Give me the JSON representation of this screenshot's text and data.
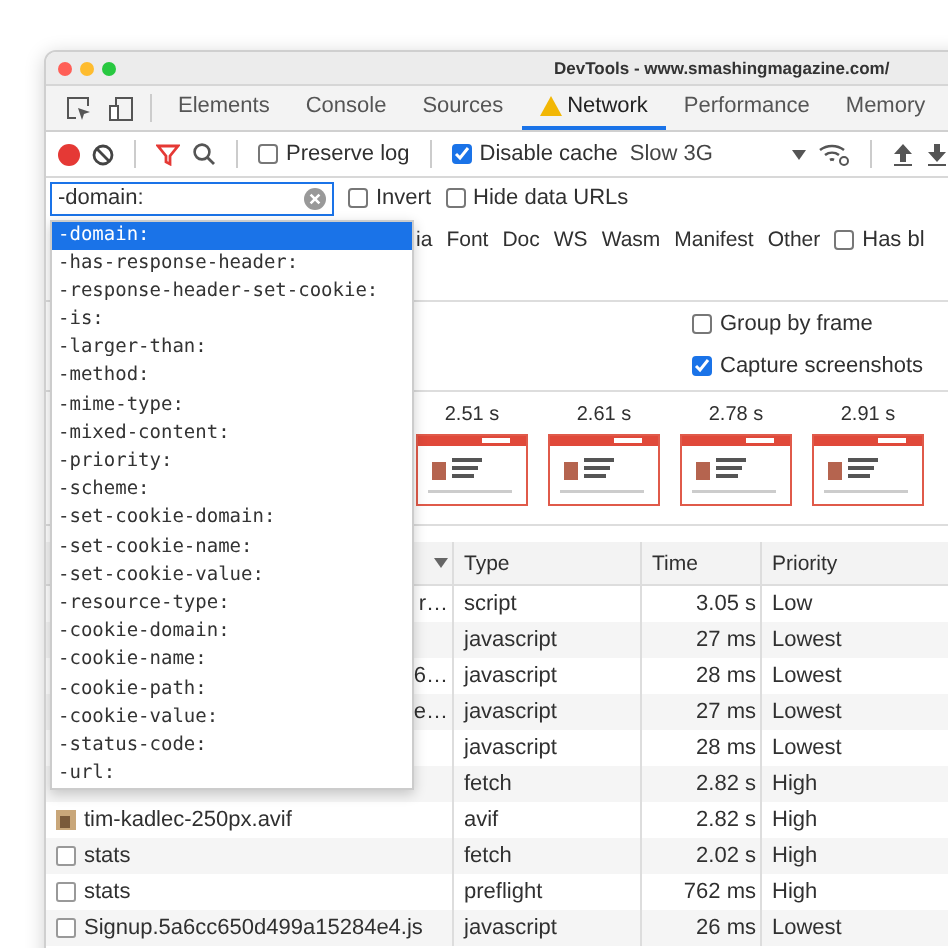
{
  "window": {
    "title": "DevTools - www.smashingmagazine.com/"
  },
  "tabs": [
    {
      "label": "Elements",
      "selected": false,
      "warning": false
    },
    {
      "label": "Console",
      "selected": false,
      "warning": false
    },
    {
      "label": "Sources",
      "selected": false,
      "warning": false
    },
    {
      "label": "Network",
      "selected": true,
      "warning": true
    },
    {
      "label": "Performance",
      "selected": false,
      "warning": false
    },
    {
      "label": "Memory",
      "selected": false,
      "warning": false
    }
  ],
  "toolbar": {
    "recording": true,
    "filter_active": true,
    "preserve_log": {
      "label": "Preserve log",
      "checked": false
    },
    "disable_cache": {
      "label": "Disable cache",
      "checked": true
    },
    "throttling": "Slow 3G"
  },
  "filter": {
    "value": "-domain:",
    "invert": {
      "label": "Invert",
      "checked": false
    },
    "hide_data_urls": {
      "label": "Hide data URLs",
      "checked": false
    }
  },
  "type_filters": [
    "ia",
    "Font",
    "Doc",
    "WS",
    "Wasm",
    "Manifest",
    "Other"
  ],
  "has_blocked": {
    "label": "Has bl",
    "checked": false
  },
  "settings": [
    {
      "label": "Group by frame",
      "checked": false
    },
    {
      "label": "Capture screenshots",
      "checked": true
    }
  ],
  "filmstrip": [
    {
      "time": "2.51 s"
    },
    {
      "time": "2.61 s"
    },
    {
      "time": "2.78 s"
    },
    {
      "time": "2.91 s"
    }
  ],
  "table": {
    "columns": [
      "Type",
      "Time",
      "Priority"
    ],
    "rows": [
      {
        "kind": "hidden",
        "name": "r…",
        "type": "script",
        "time": "3.05 s",
        "priority": "Low"
      },
      {
        "kind": "hidden",
        "type": "javascript",
        "time": "27 ms",
        "priority": "Lowest"
      },
      {
        "kind": "hidden",
        "name": "6…",
        "type": "javascript",
        "time": "28 ms",
        "priority": "Lowest"
      },
      {
        "kind": "hidden",
        "name": "e…",
        "type": "javascript",
        "time": "27 ms",
        "priority": "Lowest"
      },
      {
        "kind": "hidden",
        "type": "javascript",
        "time": "28 ms",
        "priority": "Lowest"
      },
      {
        "kind": "hidden",
        "type": "fetch",
        "time": "2.82 s",
        "priority": "High"
      },
      {
        "kind": "image",
        "name": "tim-kadlec-250px.avif",
        "type": "avif",
        "time": "2.82 s",
        "priority": "High"
      },
      {
        "kind": "document",
        "name": "stats",
        "type": "fetch",
        "time": "2.02 s",
        "priority": "High"
      },
      {
        "kind": "document",
        "name": "stats",
        "type": "preflight",
        "time": "762 ms",
        "priority": "High"
      },
      {
        "kind": "document",
        "name": "Signup.5a6cc650d499a15284e4.js",
        "type": "javascript",
        "time": "26 ms",
        "priority": "Lowest"
      }
    ]
  },
  "autocomplete": [
    {
      "text": "-domain:",
      "selected": true
    },
    {
      "text": "-has-response-header:",
      "selected": false
    },
    {
      "text": "-response-header-set-cookie:",
      "selected": false
    },
    {
      "text": "-is:",
      "selected": false
    },
    {
      "text": "-larger-than:",
      "selected": false
    },
    {
      "text": "-method:",
      "selected": false
    },
    {
      "text": "-mime-type:",
      "selected": false
    },
    {
      "text": "-mixed-content:",
      "selected": false
    },
    {
      "text": "-priority:",
      "selected": false
    },
    {
      "text": "-scheme:",
      "selected": false
    },
    {
      "text": "-set-cookie-domain:",
      "selected": false
    },
    {
      "text": "-set-cookie-name:",
      "selected": false
    },
    {
      "text": "-set-cookie-value:",
      "selected": false
    },
    {
      "text": "-resource-type:",
      "selected": false
    },
    {
      "text": "-cookie-domain:",
      "selected": false
    },
    {
      "text": "-cookie-name:",
      "selected": false
    },
    {
      "text": "-cookie-path:",
      "selected": false
    },
    {
      "text": "-cookie-value:",
      "selected": false
    },
    {
      "text": "-status-code:",
      "selected": false
    },
    {
      "text": "-url:",
      "selected": false
    }
  ]
}
